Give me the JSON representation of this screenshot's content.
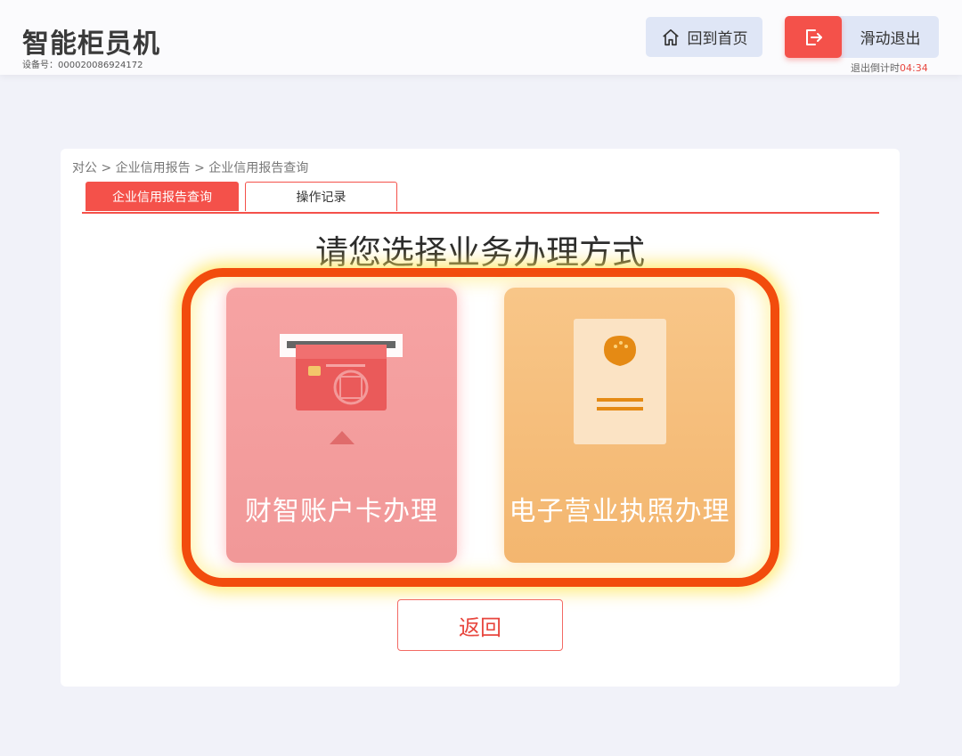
{
  "header": {
    "app_title": "智能柜员机",
    "device_id": "设备号：000020086924172",
    "home_label": "回到首页",
    "exit_label": "滑动退出",
    "countdown_label": "退出倒计时",
    "countdown_time": "04:34"
  },
  "breadcrumb": "对公 > 企业信用报告 > 企业信用报告查询",
  "tabs": [
    {
      "label": "企业信用报告查询",
      "active": true
    },
    {
      "label": "操作记录",
      "active": false
    }
  ],
  "prompt": "请您选择业务办理方式",
  "options": [
    {
      "label": "财智账户卡办理",
      "icon": "card-insert-icon",
      "color": "#f19898"
    },
    {
      "label": "电子营业执照办理",
      "icon": "business-license-icon",
      "color": "#f3b66f"
    }
  ],
  "back_label": "返回",
  "colors": {
    "accent": "#f4514a",
    "highlight_ring": "#f24c0d",
    "background": "#f1f2f9"
  }
}
